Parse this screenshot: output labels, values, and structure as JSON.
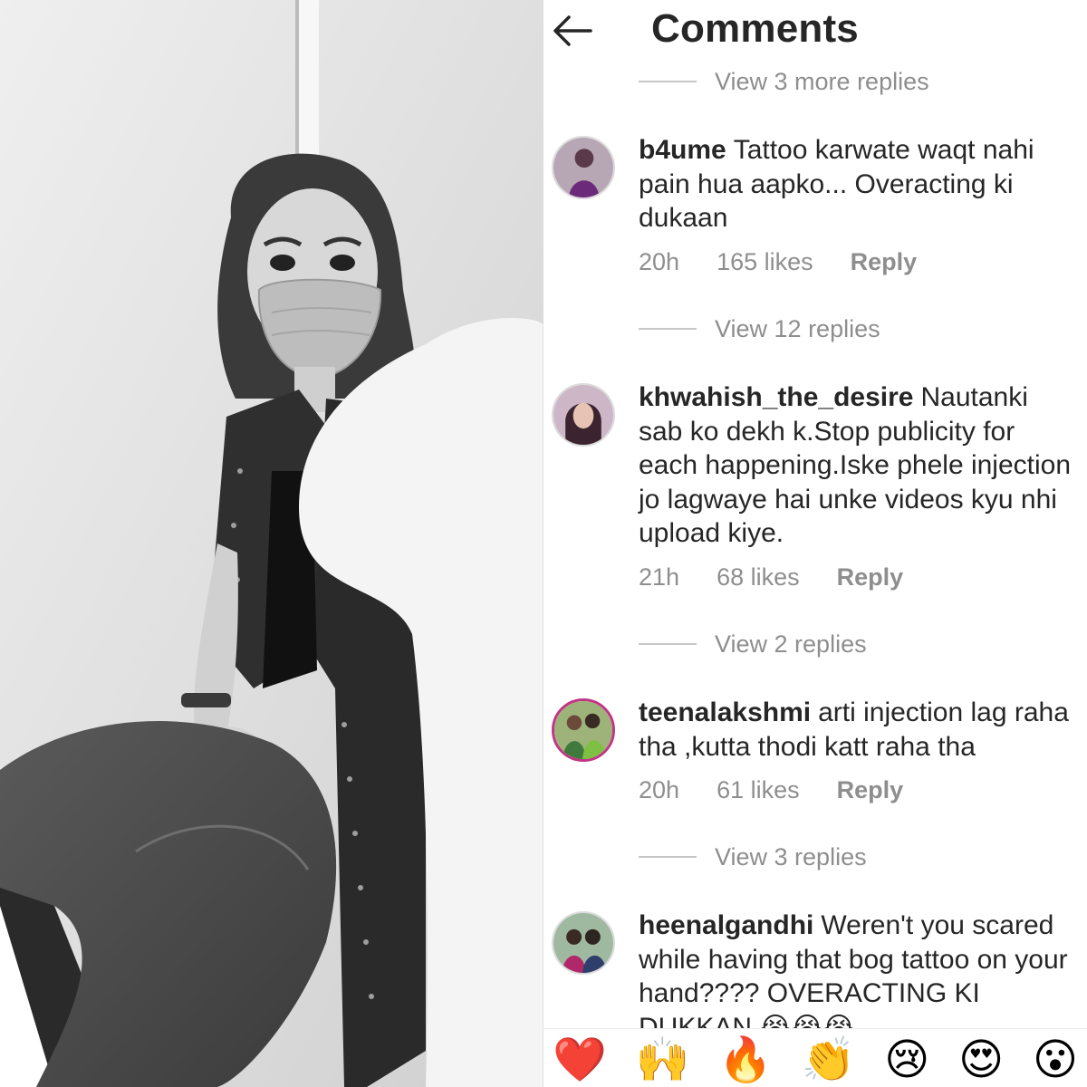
{
  "header": {
    "title": "Comments"
  },
  "top_view_more": "View 3 more replies",
  "comments": [
    {
      "username": "b4ume",
      "text": "Tattoo karwate waqt nahi pain hua aapko... Overacting ki dukaan",
      "time": "20h",
      "likes": "165 likes",
      "reply_label": "Reply",
      "view_replies": "View 12 replies"
    },
    {
      "username": "khwahish_the_desire",
      "text": "Nautanki sab ko dekh k.Stop publicity for each happening.Iske phele injection jo lagwaye hai unke videos kyu nhi upload kiye.",
      "time": "21h",
      "likes": "68 likes",
      "reply_label": "Reply",
      "view_replies": "View 2 replies"
    },
    {
      "username": "teenalakshmi",
      "text": "arti injection  lag raha tha ,kutta thodi katt raha tha",
      "time": "20h",
      "likes": "61 likes",
      "reply_label": "Reply",
      "view_replies": "View 3 replies"
    },
    {
      "username": "heenalgandhi",
      "text": "Weren't you scared while having that bog tattoo on your hand???? OVERACTING KI DUKKAN 😭😭😭"
    }
  ],
  "emoji_bar": [
    "❤️",
    "🙌",
    "🔥",
    "👏",
    "😢",
    "😍",
    "😮"
  ],
  "colors": {
    "text": "#262626",
    "muted": "#8e8e8e",
    "story_ring": "#c13584",
    "heart": "#ed4956"
  }
}
